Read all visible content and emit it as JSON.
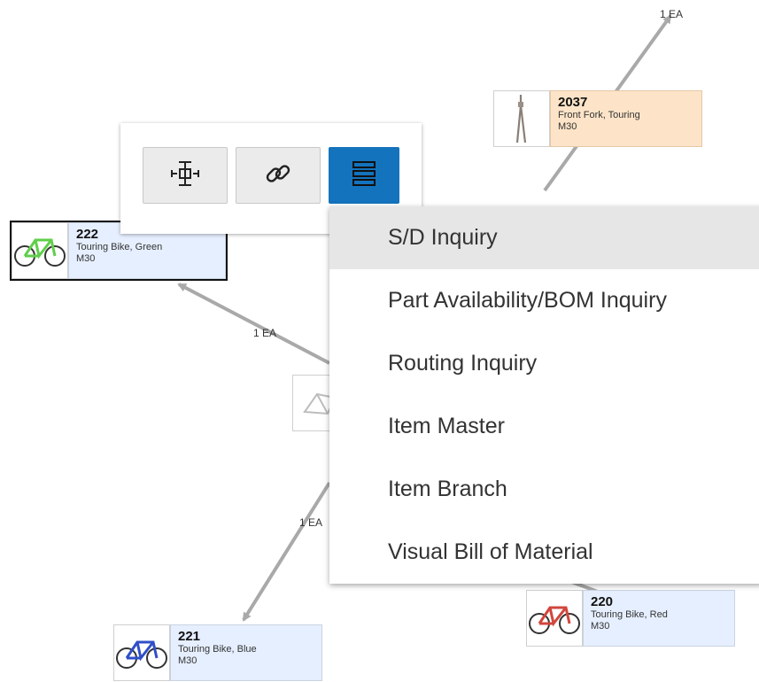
{
  "links": [
    {
      "qty": "1 EA"
    },
    {
      "qty": "1 EA"
    },
    {
      "qty": "1 EA"
    }
  ],
  "nodes": {
    "n2037": {
      "number": "2037",
      "description": "Front Fork, Touring",
      "branch": "M30",
      "color": "#fde4c8"
    },
    "n222": {
      "number": "222",
      "description": "Touring Bike, Green",
      "branch": "M30",
      "color": "#e6efff",
      "selected": true
    },
    "n220": {
      "number": "220",
      "description": "Touring Bike, Red",
      "branch": "M30",
      "color": "#e6efff"
    },
    "n221": {
      "number": "221",
      "description": "Touring Bike, Blue",
      "branch": "M30",
      "color": "#e6efff"
    }
  },
  "toolbar": {
    "buttons": [
      {
        "icon": "center-node-icon",
        "active": false
      },
      {
        "icon": "link-icon",
        "active": false
      },
      {
        "icon": "menu-list-icon",
        "active": true
      }
    ]
  },
  "menu": {
    "items": [
      "S/D Inquiry",
      "Part Availability/BOM Inquiry",
      "Routing Inquiry",
      "Item Master",
      "Item Branch",
      "Visual Bill of Material"
    ],
    "highlighted_index": 0
  },
  "colors": {
    "accent": "#1473bd",
    "link_line": "#a9a9a9"
  }
}
